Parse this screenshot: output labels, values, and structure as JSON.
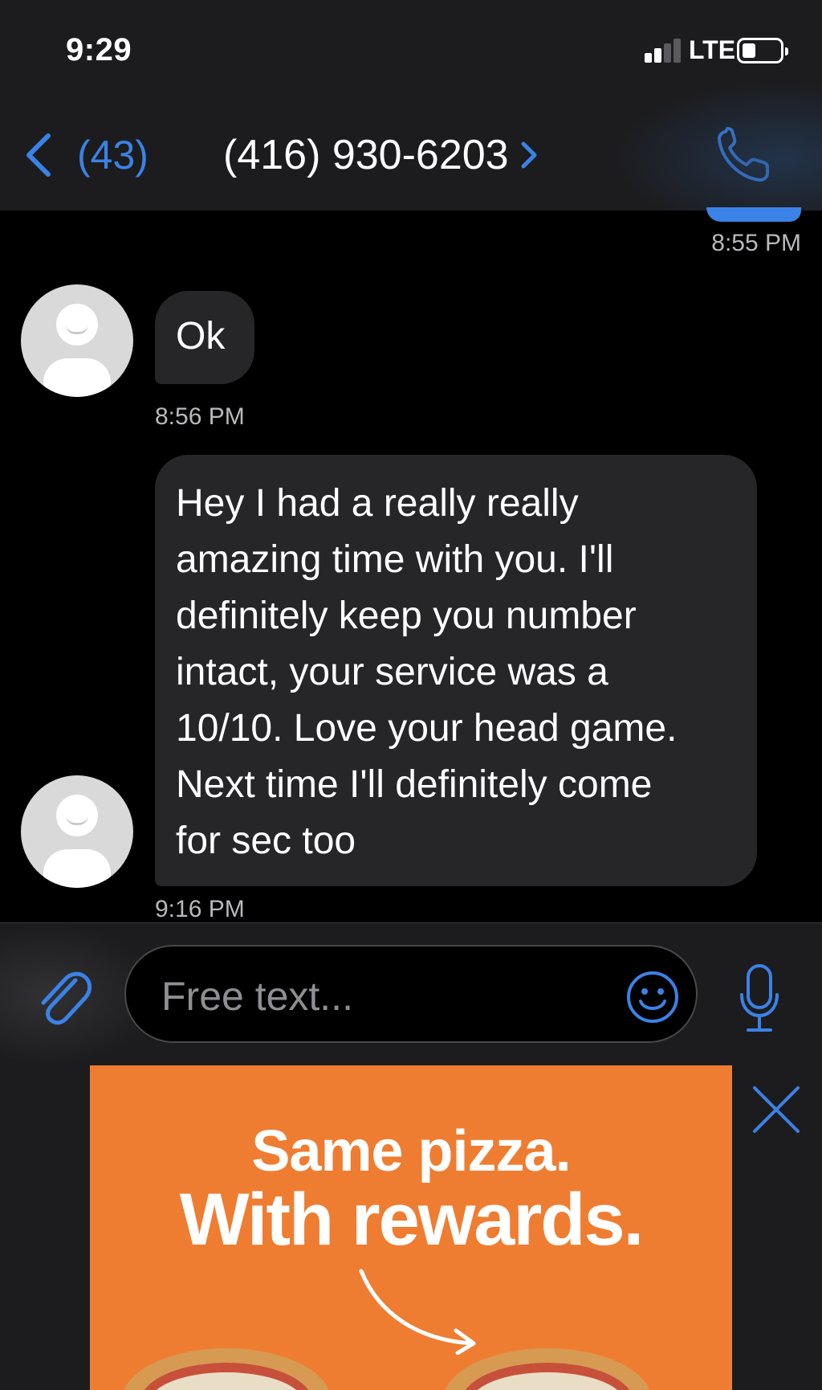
{
  "status_bar": {
    "time": "9:29",
    "network": "LTE"
  },
  "nav": {
    "back_count": "(43)",
    "contact_name": "(416) 930-6203",
    "accent_color": "#3b82e6"
  },
  "messages": [
    {
      "timestamp": "8:55 PM",
      "direction": "outgoing"
    },
    {
      "text": "Ok",
      "timestamp": "8:56 PM",
      "direction": "incoming"
    },
    {
      "text_lines": [
        "Hey I had a really really",
        "amazing time with you. I'll",
        "definitely keep you number",
        "intact, your service was a",
        "10/10. Love your head game.",
        "Next time I'll definitely come",
        "for sec too"
      ],
      "timestamp": "9:16 PM",
      "direction": "incoming"
    }
  ],
  "compose": {
    "placeholder": "Free text...",
    "icons": [
      "paperclip-icon",
      "emoji-icon",
      "microphone-icon"
    ]
  },
  "ad": {
    "line1": "Same pizza.",
    "line2": "With rewards.",
    "background_color": "#ef7d31"
  }
}
